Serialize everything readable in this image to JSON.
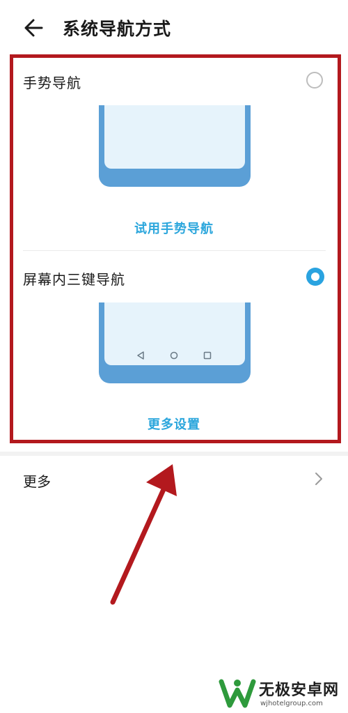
{
  "header": {
    "title": "系统导航方式"
  },
  "options": [
    {
      "label": "手势导航",
      "selected": false,
      "action": "试用手势导航"
    },
    {
      "label": "屏幕内三键导航",
      "selected": true,
      "action": "更多设置"
    }
  ],
  "more": {
    "label": "更多"
  },
  "watermark": {
    "brand": "无极安卓网",
    "url": "wjhotelgroup.com"
  },
  "colors": {
    "accent": "#2ba6dc",
    "radio_selected": "#2aa3e0",
    "annotation_red": "#b3191e",
    "phone_body": "#5b9fd6",
    "phone_screen": "#e6f3fb"
  }
}
